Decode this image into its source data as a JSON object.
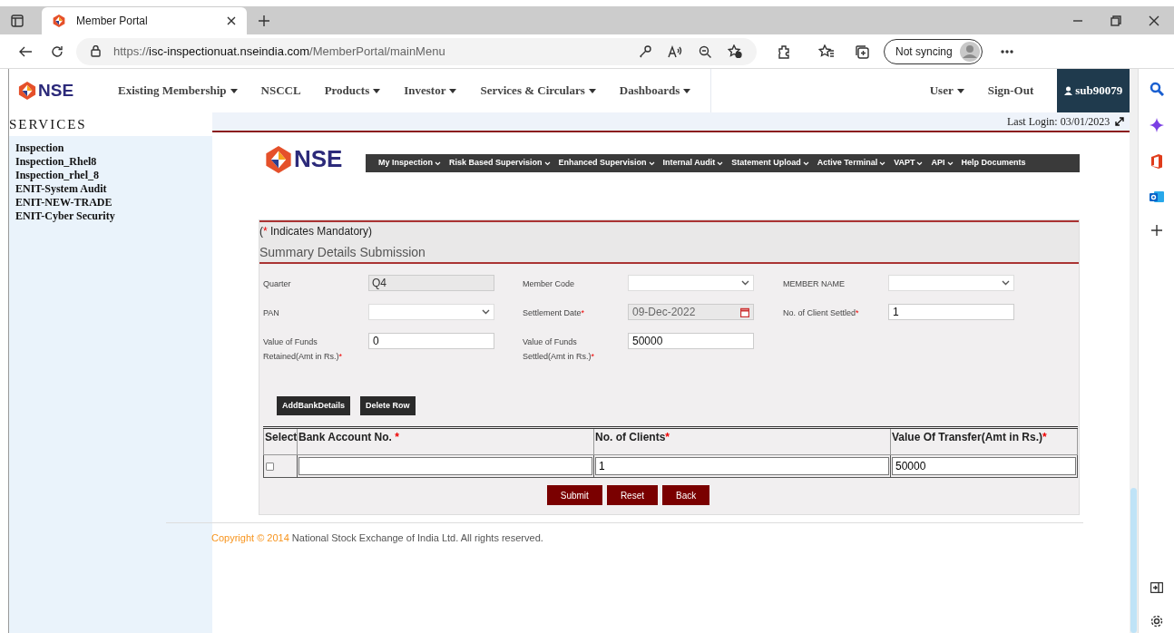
{
  "browser": {
    "tab_title": "Member Portal",
    "url_scheme": "https://",
    "url_host": "isc-inspectionuat.nseindia.com",
    "url_path": "/MemberPortal/mainMenu",
    "profile": "Not syncing"
  },
  "header": {
    "logo": "NSE",
    "nav": [
      {
        "label": "Existing Membership",
        "dropdown": true
      },
      {
        "label": "NSCCL",
        "dropdown": false
      },
      {
        "label": "Products",
        "dropdown": true
      },
      {
        "label": "Investor",
        "dropdown": true
      },
      {
        "label": "Services & Circulars",
        "dropdown": true
      },
      {
        "label": "Dashboards",
        "dropdown": true
      }
    ],
    "right": [
      {
        "label": "User",
        "dropdown": true
      },
      {
        "label": "Sign-Out",
        "dropdown": false
      }
    ],
    "user": "sub90079"
  },
  "sidebar": {
    "title": "SERVICES",
    "items": [
      "Inspection",
      "Inspection_Rhel8",
      "Inspection_rhel_8",
      "ENIT-System Audit",
      "ENIT-NEW-TRADE",
      "ENIT-Cyber Security"
    ]
  },
  "last_login": "Last Login: 03/01/2023",
  "portal": {
    "logo": "NSE",
    "menu": [
      {
        "label": "My Inspection",
        "dropdown": true
      },
      {
        "label": "Risk Based Supervision",
        "dropdown": true
      },
      {
        "label": "Enhanced Supervision",
        "dropdown": true
      },
      {
        "label": "Internal Audit",
        "dropdown": true
      },
      {
        "label": "Statement Upload",
        "dropdown": true
      },
      {
        "label": "Active Terminal",
        "dropdown": true
      },
      {
        "label": "VAPT",
        "dropdown": true
      },
      {
        "label": "API",
        "dropdown": true
      },
      {
        "label": "Help Documents",
        "dropdown": false
      }
    ]
  },
  "form": {
    "note": {
      "open": "(",
      "mark": "*",
      "text": " Indicates Mandatory)"
    },
    "title": "Summary Details Submission",
    "fields": [
      {
        "label": "Quarter",
        "kind": "readonly",
        "value": "Q4"
      },
      {
        "label": "Member Code",
        "kind": "select"
      },
      {
        "label": "MEMBER NAME",
        "kind": "select"
      },
      {
        "label": "PAN",
        "kind": "select"
      },
      {
        "label": "Settlement Date",
        "mark": "*",
        "kind": "date",
        "value": "09-Dec-2022"
      },
      {
        "label": "No. of Client Settled",
        "mark": "*",
        "kind": "text",
        "value": "1"
      },
      {
        "label": "Value of Funds Retained(Amt in Rs.)",
        "mark": "*",
        "kind": "text",
        "value": "0"
      },
      {
        "label": "Value of Funds Settled(Amt in Rs.)",
        "mark": "*",
        "kind": "text",
        "value": "50000"
      }
    ],
    "actions": [
      "AddBankDetails",
      "Delete Row"
    ],
    "table": {
      "columns": [
        {
          "label": "Select"
        },
        {
          "label": "Bank Account No. ",
          "mark": "*"
        },
        {
          "label": "No. of Clients",
          "mark": "*"
        },
        {
          "label": "Value Of Transfer(Amt in Rs.)",
          "mark": "*"
        }
      ],
      "rows": [
        {
          "checked": false,
          "clients": "1",
          "transfer": "50000"
        }
      ]
    },
    "buttons": [
      "Submit",
      "Reset",
      "Back"
    ]
  },
  "footer": {
    "copyright": "Copyright © 2014",
    "text": " National Stock Exchange of India Ltd. All rights reserved."
  }
}
